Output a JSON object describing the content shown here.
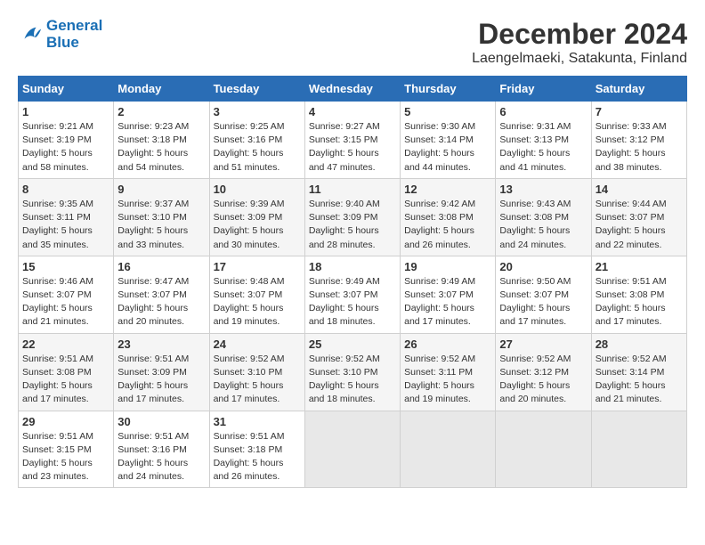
{
  "header": {
    "logo_line1": "General",
    "logo_line2": "Blue",
    "title": "December 2024",
    "subtitle": "Laengelmaeki, Satakunta, Finland"
  },
  "weekdays": [
    "Sunday",
    "Monday",
    "Tuesday",
    "Wednesday",
    "Thursday",
    "Friday",
    "Saturday"
  ],
  "weeks": [
    [
      {
        "day": "1",
        "sunrise": "Sunrise: 9:21 AM",
        "sunset": "Sunset: 3:19 PM",
        "daylight": "Daylight: 5 hours and 58 minutes."
      },
      {
        "day": "2",
        "sunrise": "Sunrise: 9:23 AM",
        "sunset": "Sunset: 3:18 PM",
        "daylight": "Daylight: 5 hours and 54 minutes."
      },
      {
        "day": "3",
        "sunrise": "Sunrise: 9:25 AM",
        "sunset": "Sunset: 3:16 PM",
        "daylight": "Daylight: 5 hours and 51 minutes."
      },
      {
        "day": "4",
        "sunrise": "Sunrise: 9:27 AM",
        "sunset": "Sunset: 3:15 PM",
        "daylight": "Daylight: 5 hours and 47 minutes."
      },
      {
        "day": "5",
        "sunrise": "Sunrise: 9:30 AM",
        "sunset": "Sunset: 3:14 PM",
        "daylight": "Daylight: 5 hours and 44 minutes."
      },
      {
        "day": "6",
        "sunrise": "Sunrise: 9:31 AM",
        "sunset": "Sunset: 3:13 PM",
        "daylight": "Daylight: 5 hours and 41 minutes."
      },
      {
        "day": "7",
        "sunrise": "Sunrise: 9:33 AM",
        "sunset": "Sunset: 3:12 PM",
        "daylight": "Daylight: 5 hours and 38 minutes."
      }
    ],
    [
      {
        "day": "8",
        "sunrise": "Sunrise: 9:35 AM",
        "sunset": "Sunset: 3:11 PM",
        "daylight": "Daylight: 5 hours and 35 minutes."
      },
      {
        "day": "9",
        "sunrise": "Sunrise: 9:37 AM",
        "sunset": "Sunset: 3:10 PM",
        "daylight": "Daylight: 5 hours and 33 minutes."
      },
      {
        "day": "10",
        "sunrise": "Sunrise: 9:39 AM",
        "sunset": "Sunset: 3:09 PM",
        "daylight": "Daylight: 5 hours and 30 minutes."
      },
      {
        "day": "11",
        "sunrise": "Sunrise: 9:40 AM",
        "sunset": "Sunset: 3:09 PM",
        "daylight": "Daylight: 5 hours and 28 minutes."
      },
      {
        "day": "12",
        "sunrise": "Sunrise: 9:42 AM",
        "sunset": "Sunset: 3:08 PM",
        "daylight": "Daylight: 5 hours and 26 minutes."
      },
      {
        "day": "13",
        "sunrise": "Sunrise: 9:43 AM",
        "sunset": "Sunset: 3:08 PM",
        "daylight": "Daylight: 5 hours and 24 minutes."
      },
      {
        "day": "14",
        "sunrise": "Sunrise: 9:44 AM",
        "sunset": "Sunset: 3:07 PM",
        "daylight": "Daylight: 5 hours and 22 minutes."
      }
    ],
    [
      {
        "day": "15",
        "sunrise": "Sunrise: 9:46 AM",
        "sunset": "Sunset: 3:07 PM",
        "daylight": "Daylight: 5 hours and 21 minutes."
      },
      {
        "day": "16",
        "sunrise": "Sunrise: 9:47 AM",
        "sunset": "Sunset: 3:07 PM",
        "daylight": "Daylight: 5 hours and 20 minutes."
      },
      {
        "day": "17",
        "sunrise": "Sunrise: 9:48 AM",
        "sunset": "Sunset: 3:07 PM",
        "daylight": "Daylight: 5 hours and 19 minutes."
      },
      {
        "day": "18",
        "sunrise": "Sunrise: 9:49 AM",
        "sunset": "Sunset: 3:07 PM",
        "daylight": "Daylight: 5 hours and 18 minutes."
      },
      {
        "day": "19",
        "sunrise": "Sunrise: 9:49 AM",
        "sunset": "Sunset: 3:07 PM",
        "daylight": "Daylight: 5 hours and 17 minutes."
      },
      {
        "day": "20",
        "sunrise": "Sunrise: 9:50 AM",
        "sunset": "Sunset: 3:07 PM",
        "daylight": "Daylight: 5 hours and 17 minutes."
      },
      {
        "day": "21",
        "sunrise": "Sunrise: 9:51 AM",
        "sunset": "Sunset: 3:08 PM",
        "daylight": "Daylight: 5 hours and 17 minutes."
      }
    ],
    [
      {
        "day": "22",
        "sunrise": "Sunrise: 9:51 AM",
        "sunset": "Sunset: 3:08 PM",
        "daylight": "Daylight: 5 hours and 17 minutes."
      },
      {
        "day": "23",
        "sunrise": "Sunrise: 9:51 AM",
        "sunset": "Sunset: 3:09 PM",
        "daylight": "Daylight: 5 hours and 17 minutes."
      },
      {
        "day": "24",
        "sunrise": "Sunrise: 9:52 AM",
        "sunset": "Sunset: 3:10 PM",
        "daylight": "Daylight: 5 hours and 17 minutes."
      },
      {
        "day": "25",
        "sunrise": "Sunrise: 9:52 AM",
        "sunset": "Sunset: 3:10 PM",
        "daylight": "Daylight: 5 hours and 18 minutes."
      },
      {
        "day": "26",
        "sunrise": "Sunrise: 9:52 AM",
        "sunset": "Sunset: 3:11 PM",
        "daylight": "Daylight: 5 hours and 19 minutes."
      },
      {
        "day": "27",
        "sunrise": "Sunrise: 9:52 AM",
        "sunset": "Sunset: 3:12 PM",
        "daylight": "Daylight: 5 hours and 20 minutes."
      },
      {
        "day": "28",
        "sunrise": "Sunrise: 9:52 AM",
        "sunset": "Sunset: 3:14 PM",
        "daylight": "Daylight: 5 hours and 21 minutes."
      }
    ],
    [
      {
        "day": "29",
        "sunrise": "Sunrise: 9:51 AM",
        "sunset": "Sunset: 3:15 PM",
        "daylight": "Daylight: 5 hours and 23 minutes."
      },
      {
        "day": "30",
        "sunrise": "Sunrise: 9:51 AM",
        "sunset": "Sunset: 3:16 PM",
        "daylight": "Daylight: 5 hours and 24 minutes."
      },
      {
        "day": "31",
        "sunrise": "Sunrise: 9:51 AM",
        "sunset": "Sunset: 3:18 PM",
        "daylight": "Daylight: 5 hours and 26 minutes."
      },
      null,
      null,
      null,
      null
    ]
  ]
}
